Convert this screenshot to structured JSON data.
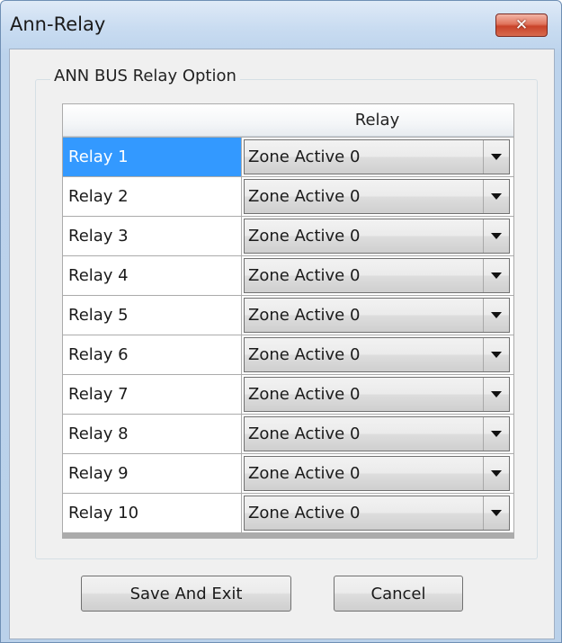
{
  "window": {
    "title": "Ann-Relay",
    "close_glyph": "✕"
  },
  "group": {
    "title": "ANN BUS Relay Option"
  },
  "grid": {
    "columns": [
      "",
      "Relay"
    ],
    "selected_row": 0,
    "rows": [
      {
        "name": "Relay 1",
        "value": "Zone Active 0"
      },
      {
        "name": "Relay 2",
        "value": "Zone Active 0"
      },
      {
        "name": "Relay 3",
        "value": "Zone Active 0"
      },
      {
        "name": "Relay 4",
        "value": "Zone Active 0"
      },
      {
        "name": "Relay 5",
        "value": "Zone Active 0"
      },
      {
        "name": "Relay 6",
        "value": "Zone Active 0"
      },
      {
        "name": "Relay 7",
        "value": "Zone Active 0"
      },
      {
        "name": "Relay 8",
        "value": "Zone Active 0"
      },
      {
        "name": "Relay 9",
        "value": "Zone Active 0"
      },
      {
        "name": "Relay 10",
        "value": "Zone Active 0"
      }
    ]
  },
  "buttons": {
    "save_label": "Save And Exit",
    "cancel_label": "Cancel"
  },
  "colors": {
    "selection": "#3399ff",
    "close_button": "#c9432a"
  }
}
